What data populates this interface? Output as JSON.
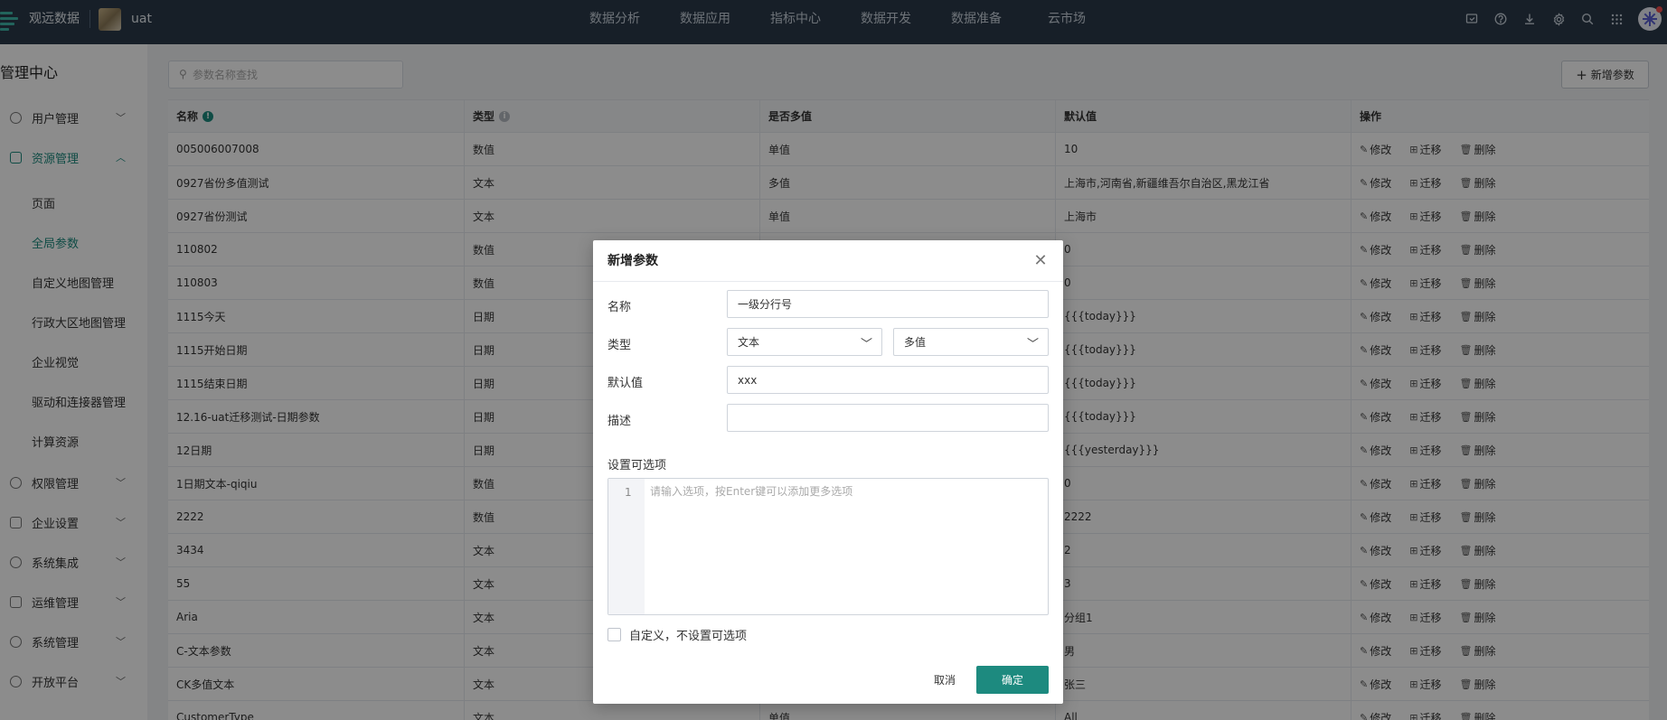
{
  "app": {
    "brand": "观远数据",
    "project": "uat",
    "accent_color": "#1d8a7f",
    "topbar_color": "#2b3a4a"
  },
  "nav": [
    "数据分析",
    "数据应用",
    "指标中心",
    "数据开发",
    "数据准备",
    "云市场"
  ],
  "tools": [
    "notification-icon",
    "help-icon",
    "download-icon",
    "settings-icon",
    "search-icon",
    "apps-grid-icon",
    "user-avatar"
  ],
  "sidebar": {
    "title": "管理中心",
    "groups": [
      {
        "label": "用户管理",
        "icon": "user-icon",
        "expanded": false
      },
      {
        "label": "资源管理",
        "icon": "resource-icon",
        "expanded": true
      },
      {
        "label": "权限管理",
        "icon": "shield-icon",
        "expanded": false
      },
      {
        "label": "企业设置",
        "icon": "building-icon",
        "expanded": false
      },
      {
        "label": "系统集成",
        "icon": "integration-icon",
        "expanded": false
      },
      {
        "label": "运维管理",
        "icon": "monitor-icon",
        "expanded": false
      },
      {
        "label": "系统管理",
        "icon": "system-icon",
        "expanded": false
      },
      {
        "label": "开放平台",
        "icon": "open-platform-icon",
        "expanded": false
      }
    ],
    "resource_items": [
      "页面",
      "全局参数",
      "自定义地图管理",
      "行政大区地图管理",
      "企业视觉",
      "驱动和连接器管理",
      "计算资源"
    ],
    "active_item": "全局参数"
  },
  "toolbar": {
    "search_placeholder": "参数名称查找",
    "add_label": "新增参数"
  },
  "table": {
    "columns": [
      "名称",
      "类型",
      "是否多值",
      "默认值",
      "操作"
    ],
    "actions": [
      "修改",
      "迁移",
      "删除"
    ],
    "rows": [
      [
        "005006007008",
        "数值",
        "单值",
        "10"
      ],
      [
        "0927省份多值测试",
        "文本",
        "多值",
        "上海市,河南省,新疆维吾尔自治区,黑龙江省"
      ],
      [
        "0927省份测试",
        "文本",
        "单值",
        "上海市"
      ],
      [
        "110802",
        "数值",
        "",
        "0"
      ],
      [
        "110803",
        "数值",
        "",
        "0"
      ],
      [
        "1115今天",
        "日期",
        "",
        "{{{today}}}"
      ],
      [
        "1115开始日期",
        "日期",
        "",
        "{{{today}}}"
      ],
      [
        "1115结束日期",
        "日期",
        "",
        "{{{today}}}"
      ],
      [
        "12.16-uat迁移测试-日期参数",
        "日期",
        "",
        "{{{today}}}"
      ],
      [
        "12日期",
        "日期",
        "",
        "{{{yesterday}}}"
      ],
      [
        "1日期文本-qiqiu",
        "数值",
        "",
        "0"
      ],
      [
        "2222",
        "数值",
        "",
        "2222"
      ],
      [
        "3434",
        "文本",
        "",
        "2"
      ],
      [
        "55",
        "文本",
        "",
        "3"
      ],
      [
        "Aria",
        "文本",
        "",
        "分组1"
      ],
      [
        "C-文本参数",
        "文本",
        "",
        "男"
      ],
      [
        "CK多值文本",
        "文本",
        "",
        "张三"
      ],
      [
        "CustomerType",
        "文本",
        "单值",
        "All"
      ]
    ]
  },
  "modal": {
    "title": "新增参数",
    "name_label": "名称",
    "name_value": "一级分行号",
    "type_label": "类型",
    "type_value": "文本",
    "multi_value": "多值",
    "default_label": "默认值",
    "default_value": "xxx",
    "desc_label": "描述",
    "desc_value": "",
    "options_label": "设置可选项",
    "options_line": "1",
    "options_placeholder": "请输入选项，按Enter键可以添加更多选项",
    "custom_label": "自定义，不设置可选项",
    "custom_checked": false,
    "cancel_label": "取消",
    "ok_label": "确定"
  }
}
